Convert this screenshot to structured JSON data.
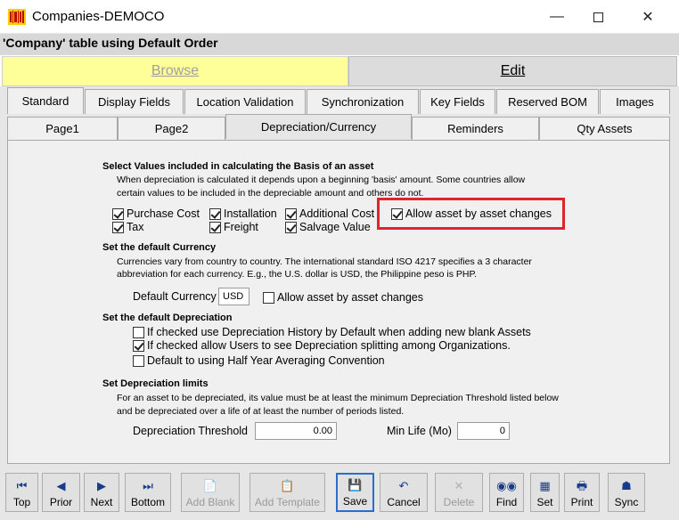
{
  "window": {
    "title": "Companies-DEMOCO",
    "icon": "app-barcode-icon",
    "controls": [
      "minimize-icon",
      "maximize-icon",
      "close-icon"
    ]
  },
  "caption": "'Company' table using Default Order",
  "modes": {
    "browse": "Browse",
    "edit": "Edit"
  },
  "tabs_row1": [
    "Standard",
    "Display Fields",
    "Location Validation",
    "Synchronization",
    "Key Fields",
    "Reserved BOM",
    "Images"
  ],
  "tabs_row2": [
    "Page1",
    "Page2",
    "Depreciation/Currency",
    "Reminders",
    "Qty Assets"
  ],
  "basis": {
    "heading": "Select Values included in calculating the Basis of an asset",
    "desc1": "When depreciation is calculated it depends upon a beginning 'basis' amount. Some countries allow",
    "desc2": "certain values to be included in the depreciable amount and others do not.",
    "purchase_cost": "Purchase Cost",
    "installation": "Installation",
    "additional_cost": "Additional Cost",
    "tax": "Tax",
    "freight": "Freight",
    "salvage_value": "Salvage Value",
    "allow_changes": "Allow asset by asset changes"
  },
  "currency": {
    "heading": "Set the default Currency",
    "desc1": "Currencies vary from country to country. The international standard ISO 4217 specifies a 3 character",
    "desc2": "abbreviation for each currency. E.g., the U.S. dollar is USD, the Philippine peso is PHP.",
    "default_label": "Default Currency",
    "default_value": "USD",
    "allow_changes": "Allow asset by asset changes"
  },
  "depreciation": {
    "heading": "Set the default Depreciation",
    "opt1": "If checked use Depreciation History by Default when adding new blank Assets",
    "opt2": "If checked allow Users to see Depreciation splitting among Organizations.",
    "opt3": "Default to using Half Year Averaging Convention"
  },
  "limits": {
    "heading": "Set Depreciation limits",
    "desc1": "For an asset to be depreciated, its value must be at least the minimum Depreciation Threshold listed below",
    "desc2": "and be depreciated over a life of at least the number of periods listed.",
    "threshold_label": "Depreciation Threshold",
    "threshold_value": "0.00",
    "minlife_label": "Min Life (Mo)",
    "minlife_value": "0"
  },
  "toolbar": {
    "top": "Top",
    "prior": "Prior",
    "next": "Next",
    "bottom": "Bottom",
    "add_blank": "Add Blank",
    "add_template": "Add Template",
    "save": "Save",
    "cancel": "Cancel",
    "delete": "Delete",
    "find": "Find",
    "set": "Set",
    "print": "Print",
    "sync": "Sync"
  },
  "highlight_color": "#e0242c"
}
